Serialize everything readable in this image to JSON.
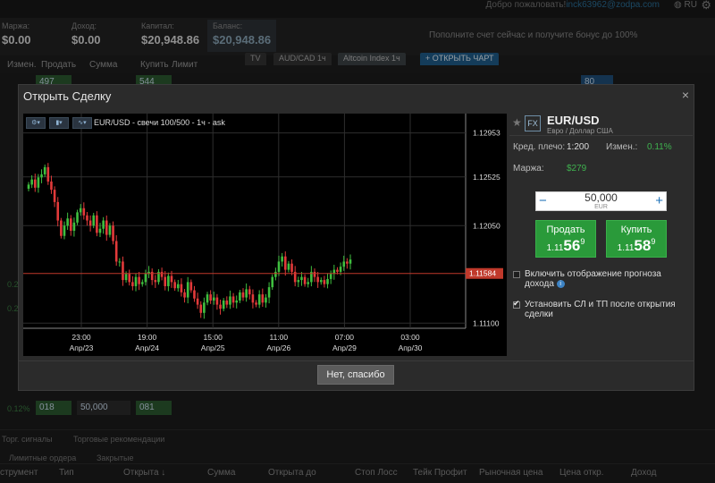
{
  "topbar": {
    "welcome_prefix": "Добро пожаловать!",
    "welcome_account": "inck63962@zodpa.com",
    "lang": "RU"
  },
  "stats": {
    "margin_label": "Маржа:",
    "margin_value": "$0.00",
    "income_label": "Доход:",
    "income_value": "$0.00",
    "capital_label": "Капитал:",
    "capital_value": "$20,948.86",
    "balance_label": "Баланс:",
    "balance_value": "$20,948.86",
    "bonus_text": "Пополните счет сейчас и получите бонус до 100%"
  },
  "bg_columns": [
    "Измен.",
    "Продать",
    "Сумма",
    "Купить",
    "Лимит"
  ],
  "bg_tabs": [
    "TV",
    "AUD/CAD 1ч",
    "Altcoin Index 1ч",
    "+ ОТКРЫТЬ ЧАРТ"
  ],
  "bg_rows": [
    "497",
    "544",
    "80",
    "018",
    "50,000",
    "081"
  ],
  "bg_side_vals": [
    "0.2",
    "0.2",
    "0.12%"
  ],
  "bottom": {
    "tabs1": [
      "Торг. сигналы",
      "Торговые рекомендации"
    ],
    "tabs2": [
      "Лимитные ордера",
      "Закрытые"
    ],
    "columns": [
      "струмент",
      "Тип",
      "Открыта ↓",
      "Сумма",
      "Открыта до",
      "Стоп Лосс",
      "Тейк Профит",
      "Рыночная цена",
      "Цена откр.",
      "Доход"
    ]
  },
  "modal": {
    "title": "Открыть Сделку",
    "close": "×",
    "chart_label": "EUR/USD - свечи 100/500 - 1ч - ask",
    "no_thanks": "Нет, спасибо"
  },
  "panel": {
    "fx": "FX",
    "symbol": "EUR/USD",
    "symbol_desc": "Евро / Доллар США",
    "leverage_label": "Кред. плечо:",
    "leverage_value": "1:200",
    "change_label": "Измен.:",
    "change_value": "0.11%",
    "margin_label": "Маржа:",
    "margin_value": "$279",
    "amount": "50,000",
    "amount_currency": "EUR",
    "sell_label": "Продать",
    "sell_small": "1.11",
    "sell_big": "56",
    "sell_sup": "9",
    "buy_label": "Купить",
    "buy_small": "1.11",
    "buy_big": "58",
    "buy_sup": "9",
    "check1_label": "Включить отображение прогноза дохода",
    "check2_label": "Установить СЛ и ТП после открытия сделки",
    "check1_checked": false,
    "check2_checked": true
  },
  "chart_data": {
    "type": "candlestick",
    "title": "EUR/USD - свечи 100/500 - 1ч - ask",
    "y_ticks": [
      "1.12953",
      "1.12525",
      "1.12050",
      "1.11100"
    ],
    "current_price": "1.11584",
    "x_ticks": [
      {
        "time": "23:00",
        "date": "Апр/23"
      },
      {
        "time": "19:00",
        "date": "Апр/24"
      },
      {
        "time": "15:00",
        "date": "Апр/25"
      },
      {
        "time": "11:00",
        "date": "Апр/26"
      },
      {
        "time": "07:00",
        "date": "Апр/29"
      },
      {
        "time": "03:00",
        "date": "Апр/30"
      }
    ],
    "ylim": [
      1.1105,
      1.1302
    ],
    "close_series": [
      1.1245,
      1.125,
      1.1242,
      1.1252,
      1.1255,
      1.1262,
      1.1248,
      1.124,
      1.1228,
      1.121,
      1.1195,
      1.1205,
      1.1212,
      1.12,
      1.1208,
      1.1218,
      1.1222,
      1.1215,
      1.121,
      1.1205,
      1.1215,
      1.1198,
      1.1202,
      1.121,
      1.1196,
      1.1205,
      1.119,
      1.117,
      1.117,
      1.1152,
      1.1158,
      1.115,
      1.1146,
      1.1155,
      1.1148,
      1.115,
      1.1158,
      1.116,
      1.1152,
      1.115,
      1.116,
      1.1155,
      1.1146,
      1.1156,
      1.115,
      1.1144,
      1.1148,
      1.114,
      1.1135,
      1.115,
      1.1142,
      1.1134,
      1.1128,
      1.112,
      1.113,
      1.1138,
      1.1132,
      1.1135,
      1.1128,
      1.1124,
      1.1132,
      1.1128,
      1.1136,
      1.113,
      1.1132,
      1.114,
      1.1135,
      1.1143,
      1.1138,
      1.113,
      1.1128,
      1.1138,
      1.113,
      1.1135,
      1.1145,
      1.1155,
      1.116,
      1.117,
      1.1175,
      1.1162,
      1.1168,
      1.116,
      1.115,
      1.1152,
      1.1155,
      1.1148,
      1.115,
      1.116,
      1.1155,
      1.115,
      1.1152,
      1.1148,
      1.1153,
      1.1158,
      1.1162,
      1.116,
      1.1165,
      1.117,
      1.1168,
      1.1172
    ]
  }
}
